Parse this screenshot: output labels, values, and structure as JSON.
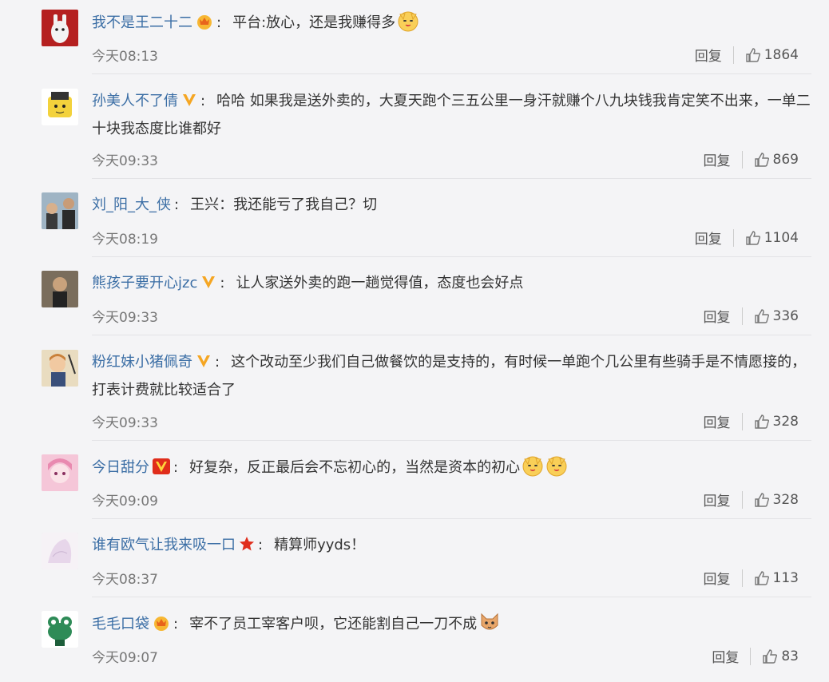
{
  "comments": [
    {
      "user": "我不是王二十二",
      "badge": "crown",
      "text": "平台:放心，还是我赚得多",
      "emojis": [
        "doge"
      ],
      "time": "今天08:13",
      "reply": "回复",
      "likes": "1864"
    },
    {
      "user": "孙美人不了倩",
      "badge": "v-yellow",
      "text": "哈哈 如果我是送外卖的，大夏天跑个三五公里一身汗就赚个八九块钱我肯定笑不出来，一单二十块我态度比谁都好",
      "emojis": [],
      "time": "今天09:33",
      "reply": "回复",
      "likes": "869"
    },
    {
      "user": "刘_阳_大_侠",
      "badge": "",
      "text": "王兴：我还能亏了我自己？切",
      "emojis": [],
      "time": "今天08:19",
      "reply": "回复",
      "likes": "1104"
    },
    {
      "user": "熊孩子要开心jzc",
      "badge": "v-yellow",
      "text": "让人家送外卖的跑一趟觉得值，态度也会好点",
      "emojis": [],
      "time": "今天09:33",
      "reply": "回复",
      "likes": "336"
    },
    {
      "user": "粉红妹小猪佩奇",
      "badge": "v-yellow",
      "text": "这个改动至少我们自己做餐饮的是支持的，有时候一单跑个几公里有些骑手是不情愿接的，打表计费就比较适合了",
      "emojis": [],
      "time": "今天09:33",
      "reply": "回复",
      "likes": "328"
    },
    {
      "user": "今日甜分",
      "badge": "v-red",
      "text": "好复杂，反正最后会不忘初心的，当然是资本的初心",
      "emojis": [
        "doge",
        "doge"
      ],
      "time": "今天09:09",
      "reply": "回复",
      "likes": "328"
    },
    {
      "user": "谁有欧气让我来吸一口",
      "badge": "star",
      "text": "精算师yyds！",
      "emojis": [],
      "time": "今天08:37",
      "reply": "回复",
      "likes": "113"
    },
    {
      "user": "毛毛口袋",
      "badge": "crown",
      "text": "宰不了员工宰客户呗，它还能割自己一刀不成",
      "emojis": [
        "cat"
      ],
      "time": "今天09:07",
      "reply": "回复",
      "likes": "83"
    }
  ],
  "colors": {
    "username": "#3b6ea5",
    "background": "#f4f4f6",
    "badge_yellow": "#f5a623",
    "badge_red": "#e02d1b"
  }
}
